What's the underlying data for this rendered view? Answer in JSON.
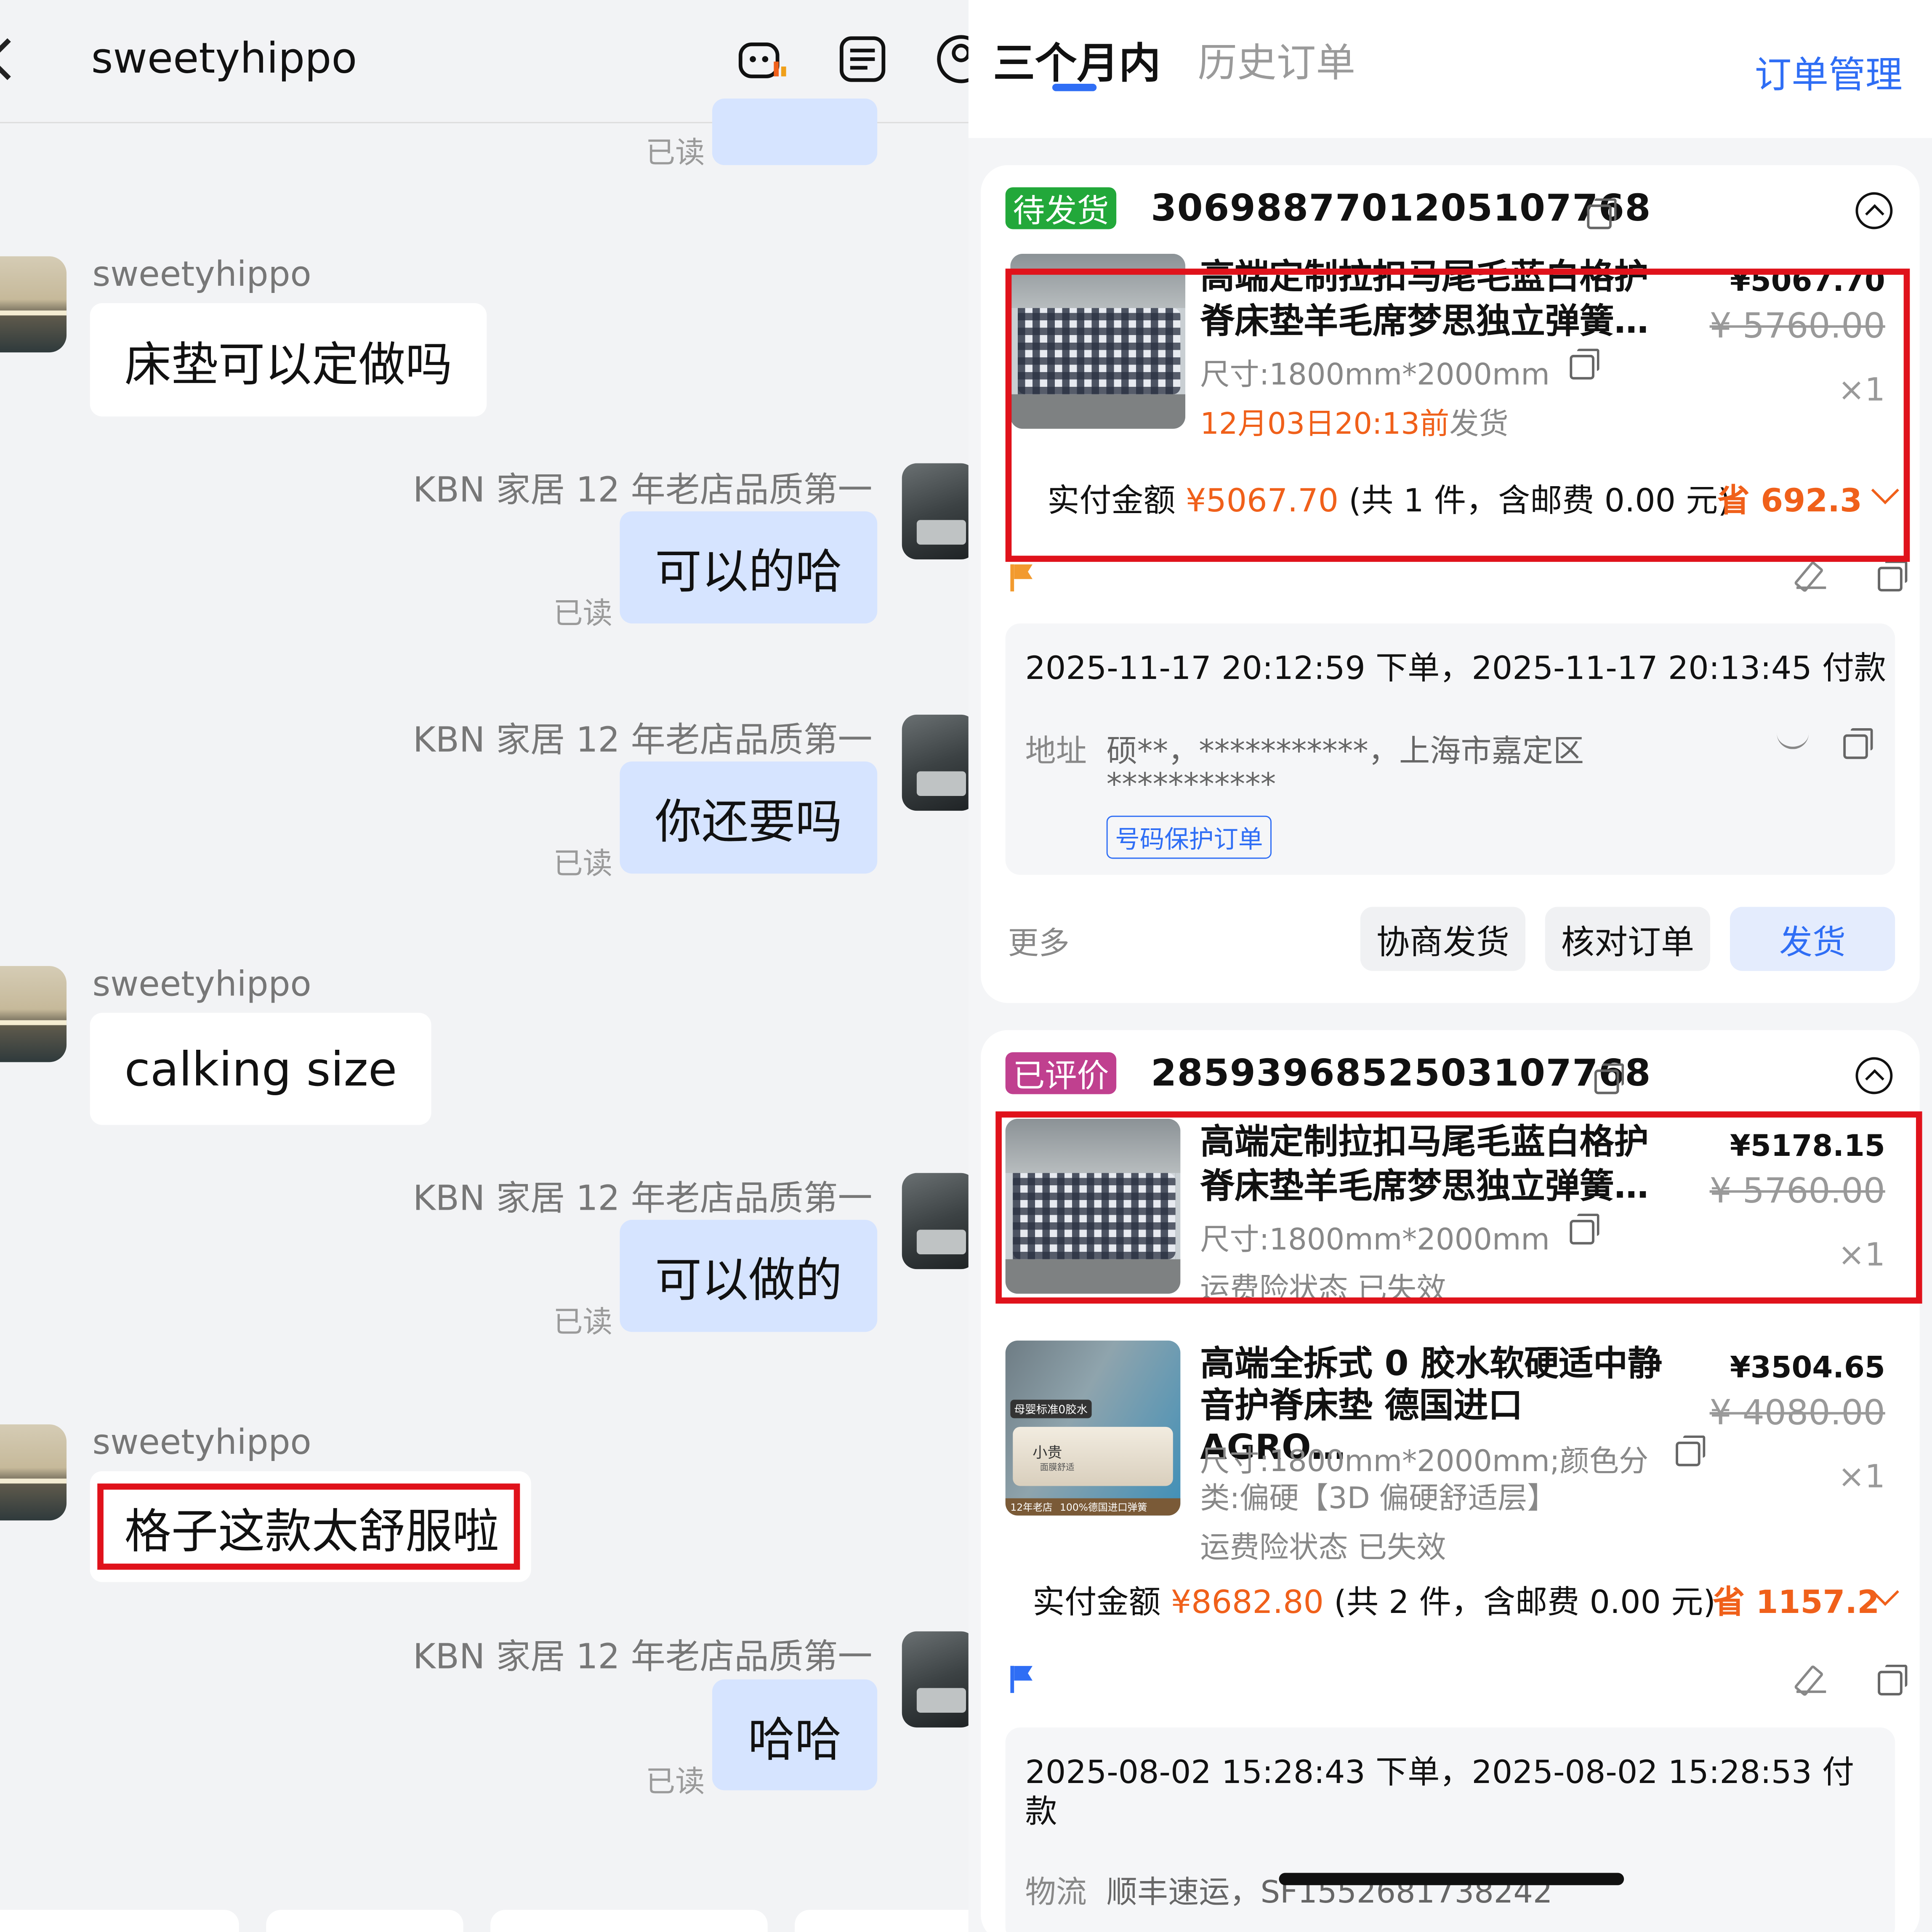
{
  "chat": {
    "title": "sweetyhippo",
    "icons": [
      "robot-icon",
      "note-icon",
      "user-icon"
    ],
    "top_partial": {
      "read": "已读"
    },
    "messages": [
      {
        "side": "in",
        "sender": "sweetyhippo",
        "text": "床垫可以定做吗"
      },
      {
        "side": "out",
        "sender": "KBN 家居 12 年老店品质第一",
        "text": "可以的哈",
        "read": "已读"
      },
      {
        "side": "out",
        "sender": "KBN 家居 12 年老店品质第一",
        "text": "你还要吗",
        "read": "已读"
      },
      {
        "side": "in",
        "sender": "sweetyhippo",
        "text": "calking size"
      },
      {
        "side": "out",
        "sender": "KBN 家居 12 年老店品质第一",
        "text": "可以做的",
        "read": "已读"
      },
      {
        "side": "in",
        "sender": "sweetyhippo",
        "text": "格子这款太舒服啦",
        "highlighted": true
      },
      {
        "side": "out",
        "sender": "KBN 家居 12 年老店品质第一",
        "text": "哈哈",
        "read": "已读"
      }
    ]
  },
  "orders": {
    "tabs": [
      {
        "label": "三个月内",
        "active": true
      },
      {
        "label": "历史订单",
        "active": false
      }
    ],
    "manage_label": "订单管理",
    "order1": {
      "status": "待发货",
      "status_color": "#22a83a",
      "number": "3069887701205107768",
      "item": {
        "name_line1": "高端定制拉扣马尾毛蓝白格护",
        "name_line2": "脊床垫羊毛席梦思独立弹簧…",
        "price": "¥5067.70",
        "original_price": "¥ 5760.00",
        "spec": "尺寸:1800mm*2000mm",
        "ship_time": "12月03日20:13前",
        "ship_suffix": "发货",
        "qty": "×1"
      },
      "pay_label": "实付金额",
      "pay_amount": "¥5067.70",
      "pay_detail": "(共 1 件，含邮费 0.00 元)",
      "saved": "省 692.3",
      "flag_color": "#f29a2e",
      "timeline": "2025-11-17 20:12:59 下单，2025-11-17 20:13:45 付款",
      "address_label": "地址",
      "address_value": "硕**，***********，上海市嘉定区",
      "address_line2": "***********",
      "protect_tag": "号码保护订单",
      "more_label": "更多",
      "buttons": [
        "协商发货",
        "核对订单",
        "发货"
      ]
    },
    "order2": {
      "status": "已评价",
      "status_color": "#c0408f",
      "number": "2859396852503107768",
      "items": [
        {
          "name_line1": "高端定制拉扣马尾毛蓝白格护",
          "name_line2": "脊床垫羊毛席梦思独立弹簧…",
          "price": "¥5178.15",
          "original_price": "¥ 5760.00",
          "spec": "尺寸:1800mm*2000mm",
          "insurance": "运费险状态 已失效",
          "qty": "×1"
        },
        {
          "name_line1": "高端全拆式 0 胶水软硬适中静",
          "name_line2": "音护脊床垫 德国进口 AGRO…",
          "price": "¥3504.65",
          "original_price": "¥ 4080.00",
          "spec_line1": "尺寸:1800mm*2000mm;颜色分",
          "spec_line2": "类:偏硬【3D 偏硬舒适层】",
          "insurance": "运费险状态 已失效",
          "qty": "×1",
          "img_labels": [
            "母婴标准0胶水",
            "小贵",
            "面膜舒适",
            "12年老店",
            "100%德国进口弹簧"
          ]
        }
      ],
      "pay_label": "实付金额",
      "pay_amount": "¥8682.80",
      "pay_detail": "(共 2 件，含邮费 0.00 元)",
      "saved": "省 1157.2",
      "flag_color": "#2f6ef5",
      "timeline_line1": "2025-08-02 15:28:43 下单，2025-08-02 15:28:53 付",
      "timeline_line2": "款",
      "logistics_label": "物流",
      "logistics_value": "顺丰速运，SF1552681738242"
    }
  }
}
